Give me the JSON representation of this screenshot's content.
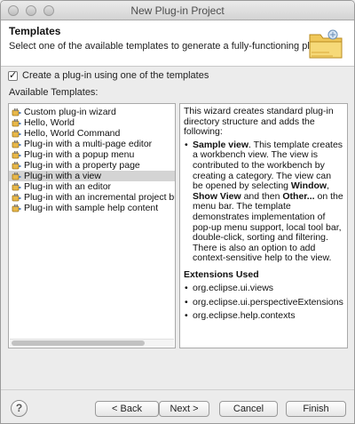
{
  "window": {
    "title": "New Plug-in Project"
  },
  "header": {
    "title": "Templates",
    "description": "Select one of the available templates to generate a fully-functioning plug-in."
  },
  "checkbox": {
    "label": "Create a plug-in using one of the templates",
    "checked": true
  },
  "templates": {
    "label": "Available Templates:",
    "selected_index": 6,
    "items": [
      "Custom plug-in wizard",
      "Hello, World",
      "Hello, World Command",
      "Plug-in with a multi-page editor",
      "Plug-in with a popup menu",
      "Plug-in with a property page",
      "Plug-in with a view",
      "Plug-in with an editor",
      "Plug-in with an incremental project builder",
      "Plug-in with sample help content"
    ]
  },
  "description": {
    "intro": "This wizard creates standard plug-in directory structure and adds the following:",
    "bullet_bold": "Sample view",
    "bullet_a": ". This template creates a workbench view. The view is contributed to the workbench by creating a category. The view can be opened by selecting ",
    "window_bold": "Window",
    "comma": ", ",
    "show_view_bold": "Show View",
    "and_then": " and then ",
    "other_bold": "Other...",
    "bullet_b": " on the menu bar. The template demonstrates implementation of pop-up menu support, local tool bar, double-click, sorting and filtering. There is also an option to add context-sensitive help to the view.",
    "extensions_heading": "Extensions Used",
    "extensions": [
      "org.eclipse.ui.views",
      "org.eclipse.ui.perspectiveExtensions",
      "org.eclipse.help.contexts"
    ]
  },
  "buttons": {
    "help": "?",
    "back": "< Back",
    "next": "Next >",
    "cancel": "Cancel",
    "finish": "Finish"
  }
}
